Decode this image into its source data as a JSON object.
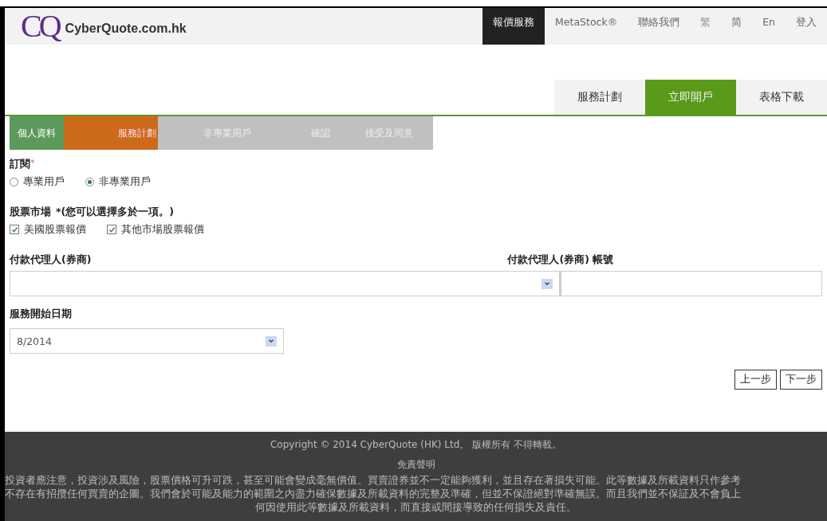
{
  "header": {
    "logo_mark": "CQ",
    "site_name": "CyberQuote.com.hk",
    "nav": [
      {
        "label": "報價服務",
        "selected": true,
        "disabled": false
      },
      {
        "label": "MetaStock®",
        "selected": false,
        "disabled": false
      },
      {
        "label": "聯絡我們",
        "selected": false,
        "disabled": false
      },
      {
        "label": "繁",
        "selected": false,
        "disabled": true
      },
      {
        "label": "简",
        "selected": false,
        "disabled": false
      },
      {
        "label": "En",
        "selected": false,
        "disabled": false
      },
      {
        "label": "登入",
        "selected": false,
        "disabled": false
      }
    ]
  },
  "subnav": [
    {
      "label": "服務計劃",
      "selected": false
    },
    {
      "label": "立即開戶",
      "selected": true
    },
    {
      "label": "表格下載",
      "selected": false
    }
  ],
  "steps": [
    {
      "label": "個人資料",
      "done": true,
      "selected": false
    },
    {
      "label": "服務計劃",
      "done": false,
      "selected": true
    },
    {
      "label": "非專業用戶",
      "done": false,
      "selected": false
    },
    {
      "label": "確認",
      "done": false,
      "selected": false
    },
    {
      "label": "接受及同意",
      "done": false,
      "selected": false
    }
  ],
  "subscription": {
    "label": "訂閱",
    "required_mark": "*",
    "options": [
      {
        "label": "專業用戶",
        "selected": false
      },
      {
        "label": "非專業用戶",
        "selected": true
      }
    ]
  },
  "market": {
    "label": "股票市場",
    "note": "*(您可以選擇多於一項。)",
    "options": [
      {
        "label": "美國股票報價",
        "checked": true
      },
      {
        "label": "其他市場股票報價",
        "checked": true
      }
    ]
  },
  "broker": {
    "label": "付款代理人(券商)",
    "account_label": "付款代理人(券商) 帳號"
  },
  "start_date": {
    "label": "服務開始日期",
    "value": "8/2014"
  },
  "buttons": [
    "上一步",
    "下一步"
  ],
  "footer": {
    "copyright": "Copyright © 2014 CyberQuote (HK) Ltd。 版權所有 不得轉載。",
    "disclaimer_title": "免責聲明",
    "disclaimer_lines": [
      "投資者應注意，投資涉及風險，股票價格可升可跌，甚至可能會變成毫無價值。買賣證券並不一定能夠獲利，並且存在著損失可能。此等數據及所載資料只作參考",
      "不存在有招攬任何買賣的企圖。我們會於可能及能力的範圍之內盡力確保數據及所載資料的完整及準確，但並不保證絕對準確無誤。而且我們並不保証及不會負上",
      "何因使用此等數據及所載資料，而直接或間接導致的任何損失及責任。"
    ]
  }
}
